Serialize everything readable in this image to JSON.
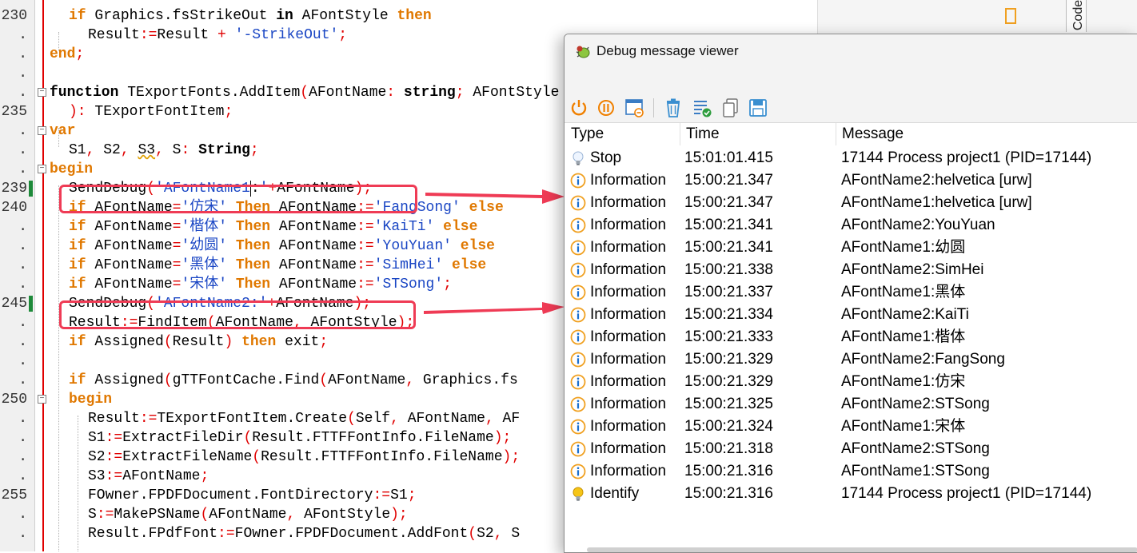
{
  "editor": {
    "lines": [
      {
        "num": "230",
        "indent": 86,
        "tokens": [
          {
            "t": "if",
            "c": "kw"
          },
          {
            "t": " Graphics.fsStrikeOut ",
            "c": "id"
          },
          {
            "t": "in",
            "c": "kwb"
          },
          {
            "t": " AFontStyle ",
            "c": "id"
          },
          {
            "t": "then",
            "c": "kw"
          }
        ]
      },
      {
        "num": ".",
        "indent": 110,
        "tokens": [
          {
            "t": "Result",
            "c": "id"
          },
          {
            "t": ":=",
            "c": "sym"
          },
          {
            "t": "Result ",
            "c": "id"
          },
          {
            "t": "+",
            "c": "sym"
          },
          {
            "t": " ",
            "c": "id"
          },
          {
            "t": "'-StrikeOut'",
            "c": "str"
          },
          {
            "t": ";",
            "c": "sym"
          }
        ]
      },
      {
        "num": ".",
        "indent": 62,
        "tokens": [
          {
            "t": "end",
            "c": "kw"
          },
          {
            "t": ";",
            "c": "sym"
          }
        ]
      },
      {
        "num": ".",
        "indent": 62,
        "tokens": []
      },
      {
        "num": ".",
        "indent": 62,
        "fold": true,
        "tokens": [
          {
            "t": "function",
            "c": "kwb"
          },
          {
            "t": " TExportFonts.AddItem",
            "c": "id"
          },
          {
            "t": "(",
            "c": "sym"
          },
          {
            "t": "AFontName",
            "c": "id"
          },
          {
            "t": ":",
            "c": "sym"
          },
          {
            "t": " ",
            "c": "id"
          },
          {
            "t": "string",
            "c": "kwb"
          },
          {
            "t": ";",
            "c": "sym"
          },
          {
            "t": " AFontStyle",
            "c": "id"
          }
        ]
      },
      {
        "num": "235",
        "indent": 86,
        "tokens": [
          {
            "t": "):",
            "c": "sym"
          },
          {
            "t": " TExportFontItem",
            "c": "id"
          },
          {
            "t": ";",
            "c": "sym"
          }
        ]
      },
      {
        "num": ".",
        "indent": 62,
        "fold": true,
        "tokens": [
          {
            "t": "var",
            "c": "kw"
          }
        ]
      },
      {
        "num": ".",
        "indent": 86,
        "tokens": [
          {
            "t": "S1",
            "c": "id"
          },
          {
            "t": ",",
            "c": "sym"
          },
          {
            "t": " S2",
            "c": "id"
          },
          {
            "t": ",",
            "c": "sym"
          },
          {
            "t": " ",
            "c": "id"
          },
          {
            "t": "S3",
            "c": "sq"
          },
          {
            "t": ",",
            "c": "sym"
          },
          {
            "t": " S",
            "c": "id"
          },
          {
            "t": ":",
            "c": "sym"
          },
          {
            "t": " ",
            "c": "id"
          },
          {
            "t": "String",
            "c": "kwb"
          },
          {
            "t": ";",
            "c": "sym"
          }
        ]
      },
      {
        "num": ".",
        "indent": 62,
        "fold": true,
        "tokens": [
          {
            "t": "begin",
            "c": "kw"
          }
        ]
      },
      {
        "num": "239",
        "indent": 86,
        "mod": true,
        "tokens": [
          {
            "t": "SendDebug",
            "c": "id"
          },
          {
            "t": "(",
            "c": "sym"
          },
          {
            "t": "'AFontName1",
            "c": "str"
          },
          {
            "t": ":",
            "c": "caret"
          },
          {
            "t": "'",
            "c": "str"
          },
          {
            "t": "+",
            "c": "sym"
          },
          {
            "t": "AFontName",
            "c": "id"
          },
          {
            "t": ");",
            "c": "sym"
          }
        ]
      },
      {
        "num": "240",
        "indent": 86,
        "tokens": [
          {
            "t": "if",
            "c": "kw"
          },
          {
            "t": " AFontName",
            "c": "id"
          },
          {
            "t": "=",
            "c": "sym"
          },
          {
            "t": "'仿宋'",
            "c": "str"
          },
          {
            "t": " ",
            "c": "id"
          },
          {
            "t": "Then",
            "c": "kw"
          },
          {
            "t": " AFontName",
            "c": "id"
          },
          {
            "t": ":=",
            "c": "sym"
          },
          {
            "t": "'FangSong'",
            "c": "str"
          },
          {
            "t": " ",
            "c": "id"
          },
          {
            "t": "else",
            "c": "kw"
          }
        ]
      },
      {
        "num": ".",
        "indent": 86,
        "tokens": [
          {
            "t": "if",
            "c": "kw"
          },
          {
            "t": " AFontName",
            "c": "id"
          },
          {
            "t": "=",
            "c": "sym"
          },
          {
            "t": "'楷体'",
            "c": "str"
          },
          {
            "t": " ",
            "c": "id"
          },
          {
            "t": "Then",
            "c": "kw"
          },
          {
            "t": " AFontName",
            "c": "id"
          },
          {
            "t": ":=",
            "c": "sym"
          },
          {
            "t": "'KaiTi'",
            "c": "str"
          },
          {
            "t": " ",
            "c": "id"
          },
          {
            "t": "else",
            "c": "kw"
          }
        ]
      },
      {
        "num": ".",
        "indent": 86,
        "tokens": [
          {
            "t": "if",
            "c": "kw"
          },
          {
            "t": " AFontName",
            "c": "id"
          },
          {
            "t": "=",
            "c": "sym"
          },
          {
            "t": "'幼圆'",
            "c": "str"
          },
          {
            "t": " ",
            "c": "id"
          },
          {
            "t": "Then",
            "c": "kw"
          },
          {
            "t": " AFontName",
            "c": "id"
          },
          {
            "t": ":=",
            "c": "sym"
          },
          {
            "t": "'YouYuan'",
            "c": "str"
          },
          {
            "t": " ",
            "c": "id"
          },
          {
            "t": "else",
            "c": "kw"
          }
        ]
      },
      {
        "num": ".",
        "indent": 86,
        "tokens": [
          {
            "t": "if",
            "c": "kw"
          },
          {
            "t": " AFontName",
            "c": "id"
          },
          {
            "t": "=",
            "c": "sym"
          },
          {
            "t": "'黑体'",
            "c": "str"
          },
          {
            "t": " ",
            "c": "id"
          },
          {
            "t": "Then",
            "c": "kw"
          },
          {
            "t": " AFontName",
            "c": "id"
          },
          {
            "t": ":=",
            "c": "sym"
          },
          {
            "t": "'SimHei'",
            "c": "str"
          },
          {
            "t": " ",
            "c": "id"
          },
          {
            "t": "else",
            "c": "kw"
          }
        ]
      },
      {
        "num": ".",
        "indent": 86,
        "tokens": [
          {
            "t": "if",
            "c": "kw"
          },
          {
            "t": " AFontName",
            "c": "id"
          },
          {
            "t": "=",
            "c": "sym"
          },
          {
            "t": "'宋体'",
            "c": "str"
          },
          {
            "t": " ",
            "c": "id"
          },
          {
            "t": "Then",
            "c": "kw"
          },
          {
            "t": " AFontName",
            "c": "id"
          },
          {
            "t": ":=",
            "c": "sym"
          },
          {
            "t": "'STSong'",
            "c": "str"
          },
          {
            "t": ";",
            "c": "sym"
          }
        ]
      },
      {
        "num": "245",
        "indent": 86,
        "mod": true,
        "tokens": [
          {
            "t": "SendDebug",
            "c": "id"
          },
          {
            "t": "(",
            "c": "sym"
          },
          {
            "t": "'AFontName2:'",
            "c": "str"
          },
          {
            "t": "+",
            "c": "sym"
          },
          {
            "t": "AFontName",
            "c": "id"
          },
          {
            "t": ");",
            "c": "sym"
          }
        ]
      },
      {
        "num": ".",
        "indent": 86,
        "tokens": [
          {
            "t": "Result",
            "c": "id"
          },
          {
            "t": ":=",
            "c": "sym"
          },
          {
            "t": "FindItem",
            "c": "id"
          },
          {
            "t": "(",
            "c": "sym"
          },
          {
            "t": "AFontName",
            "c": "id"
          },
          {
            "t": ",",
            "c": "sym"
          },
          {
            "t": " AFontStyle",
            "c": "id"
          },
          {
            "t": ");",
            "c": "sym"
          }
        ]
      },
      {
        "num": ".",
        "indent": 86,
        "tokens": [
          {
            "t": "if",
            "c": "kw"
          },
          {
            "t": " Assigned",
            "c": "id"
          },
          {
            "t": "(",
            "c": "sym"
          },
          {
            "t": "Result",
            "c": "id"
          },
          {
            "t": ")",
            "c": "sym"
          },
          {
            "t": " ",
            "c": "id"
          },
          {
            "t": "then",
            "c": "kw"
          },
          {
            "t": " exit",
            "c": "id"
          },
          {
            "t": ";",
            "c": "sym"
          }
        ]
      },
      {
        "num": ".",
        "indent": 86,
        "tokens": []
      },
      {
        "num": ".",
        "indent": 86,
        "tokens": [
          {
            "t": "if",
            "c": "kw"
          },
          {
            "t": " Assigned",
            "c": "id"
          },
          {
            "t": "(",
            "c": "sym"
          },
          {
            "t": "gTTFontCache.Find",
            "c": "id"
          },
          {
            "t": "(",
            "c": "sym"
          },
          {
            "t": "AFontName",
            "c": "id"
          },
          {
            "t": ",",
            "c": "sym"
          },
          {
            "t": " Graphics.fs",
            "c": "id"
          }
        ]
      },
      {
        "num": "250",
        "indent": 86,
        "fold": true,
        "tokens": [
          {
            "t": "begin",
            "c": "kw"
          }
        ]
      },
      {
        "num": ".",
        "indent": 110,
        "tokens": [
          {
            "t": "Result",
            "c": "id"
          },
          {
            "t": ":=",
            "c": "sym"
          },
          {
            "t": "TExportFontItem.Create",
            "c": "id"
          },
          {
            "t": "(",
            "c": "sym"
          },
          {
            "t": "Self",
            "c": "id"
          },
          {
            "t": ",",
            "c": "sym"
          },
          {
            "t": " AFontName",
            "c": "id"
          },
          {
            "t": ",",
            "c": "sym"
          },
          {
            "t": " AF",
            "c": "id"
          }
        ]
      },
      {
        "num": ".",
        "indent": 110,
        "tokens": [
          {
            "t": "S1",
            "c": "id"
          },
          {
            "t": ":=",
            "c": "sym"
          },
          {
            "t": "ExtractFileDir",
            "c": "id"
          },
          {
            "t": "(",
            "c": "sym"
          },
          {
            "t": "Result.FTTFFontInfo.FileName",
            "c": "id"
          },
          {
            "t": ");",
            "c": "sym"
          }
        ]
      },
      {
        "num": ".",
        "indent": 110,
        "tokens": [
          {
            "t": "S2",
            "c": "id"
          },
          {
            "t": ":=",
            "c": "sym"
          },
          {
            "t": "ExtractFileName",
            "c": "id"
          },
          {
            "t": "(",
            "c": "sym"
          },
          {
            "t": "Result.FTTFFontInfo.FileName",
            "c": "id"
          },
          {
            "t": ");",
            "c": "sym"
          }
        ]
      },
      {
        "num": ".",
        "indent": 110,
        "tokens": [
          {
            "t": "S3",
            "c": "id"
          },
          {
            "t": ":=",
            "c": "sym"
          },
          {
            "t": "AFontName",
            "c": "id"
          },
          {
            "t": ";",
            "c": "sym"
          }
        ]
      },
      {
        "num": "255",
        "indent": 110,
        "tokens": [
          {
            "t": "FOwner.FPDFDocument.FontDirectory",
            "c": "id"
          },
          {
            "t": ":=",
            "c": "sym"
          },
          {
            "t": "S1",
            "c": "id"
          },
          {
            "t": ";",
            "c": "sym"
          }
        ]
      },
      {
        "num": ".",
        "indent": 110,
        "tokens": [
          {
            "t": "S",
            "c": "id"
          },
          {
            "t": ":=",
            "c": "sym"
          },
          {
            "t": "MakePSName",
            "c": "id"
          },
          {
            "t": "(",
            "c": "sym"
          },
          {
            "t": "AFontName",
            "c": "id"
          },
          {
            "t": ",",
            "c": "sym"
          },
          {
            "t": " AFontStyle",
            "c": "id"
          },
          {
            "t": ");",
            "c": "sym"
          }
        ]
      },
      {
        "num": ".",
        "indent": 110,
        "tokens": [
          {
            "t": "Result.FPdfFont",
            "c": "id"
          },
          {
            "t": ":=",
            "c": "sym"
          },
          {
            "t": "FOwner.FPDFDocument.AddFont",
            "c": "id"
          },
          {
            "t": "(",
            "c": "sym"
          },
          {
            "t": "S2",
            "c": "id"
          },
          {
            "t": ",",
            "c": "sym"
          },
          {
            "t": " S",
            "c": "id"
          }
        ]
      }
    ],
    "side_tab_label": "Code"
  },
  "debug_window": {
    "title": "Debug message viewer",
    "columns": {
      "type": "Type",
      "time": "Time",
      "message": "Message"
    },
    "rows": [
      {
        "icon": "bulb-icon",
        "type": "Stop",
        "time": "15:01:01.415",
        "message": "17144 Process project1 (PID=17144)"
      },
      {
        "icon": "info-icon",
        "type": "Information",
        "time": "15:00:21.347",
        "message": "AFontName2:helvetica [urw]"
      },
      {
        "icon": "info-icon",
        "type": "Information",
        "time": "15:00:21.347",
        "message": "AFontName1:helvetica [urw]"
      },
      {
        "icon": "info-icon",
        "type": "Information",
        "time": "15:00:21.341",
        "message": "AFontName2:YouYuan"
      },
      {
        "icon": "info-icon",
        "type": "Information",
        "time": "15:00:21.341",
        "message": "AFontName1:幼圆"
      },
      {
        "icon": "info-icon",
        "type": "Information",
        "time": "15:00:21.338",
        "message": "AFontName2:SimHei"
      },
      {
        "icon": "info-icon",
        "type": "Information",
        "time": "15:00:21.337",
        "message": "AFontName1:黑体"
      },
      {
        "icon": "info-icon",
        "type": "Information",
        "time": "15:00:21.334",
        "message": "AFontName2:KaiTi"
      },
      {
        "icon": "info-icon",
        "type": "Information",
        "time": "15:00:21.333",
        "message": "AFontName1:楷体"
      },
      {
        "icon": "info-icon",
        "type": "Information",
        "time": "15:00:21.329",
        "message": "AFontName2:FangSong"
      },
      {
        "icon": "info-icon",
        "type": "Information",
        "time": "15:00:21.329",
        "message": "AFontName1:仿宋"
      },
      {
        "icon": "info-icon",
        "type": "Information",
        "time": "15:00:21.325",
        "message": "AFontName2:STSong"
      },
      {
        "icon": "info-icon",
        "type": "Information",
        "time": "15:00:21.324",
        "message": "AFontName1:宋体"
      },
      {
        "icon": "info-icon",
        "type": "Information",
        "time": "15:00:21.318",
        "message": "AFontName2:STSong"
      },
      {
        "icon": "info-icon",
        "type": "Information",
        "time": "15:00:21.316",
        "message": "AFontName1:STSong"
      },
      {
        "icon": "gold-bulb-icon",
        "type": "Identify",
        "time": "15:00:21.316",
        "message": "17144 Process project1 (PID=17144)"
      }
    ],
    "toolbar": [
      {
        "name": "power-icon"
      },
      {
        "name": "pause-icon"
      },
      {
        "name": "window-clear-icon"
      },
      {
        "name": "trash-icon"
      },
      {
        "name": "list-check-icon"
      },
      {
        "name": "copy-icon"
      },
      {
        "name": "save-icon"
      }
    ]
  },
  "colors": {
    "keyword": "#e07800",
    "string": "#1a46c4",
    "symbol": "#e00000",
    "highlight": "#ef3b55",
    "modified_marker": "#1e8a3a",
    "info_icon": "#f0a020"
  }
}
